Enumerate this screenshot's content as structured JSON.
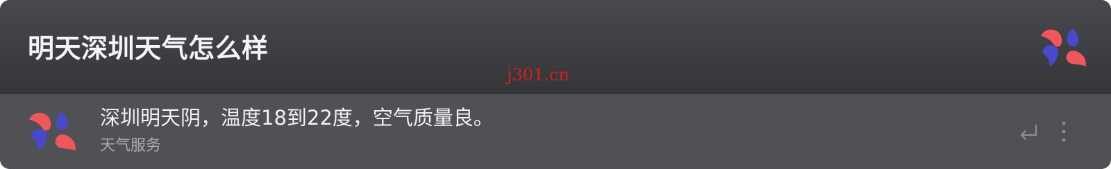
{
  "search": {
    "query": "明天深圳天气怎么样",
    "logo_icon": "app-logo-icon"
  },
  "watermark": {
    "text": "j301.cn"
  },
  "result": {
    "title": "深圳明天阴，温度18到22度，空气质量良。",
    "subtitle": "天气服务",
    "icon": "weather-service-logo-icon",
    "action_icon": "enter-return-icon",
    "menu_icon": "more-vertical-icon"
  },
  "colors": {
    "logo_red": "#f0575c",
    "logo_blue": "#4a49c9",
    "panel_dark": "#3a3b40",
    "row_bg": "#505155"
  }
}
